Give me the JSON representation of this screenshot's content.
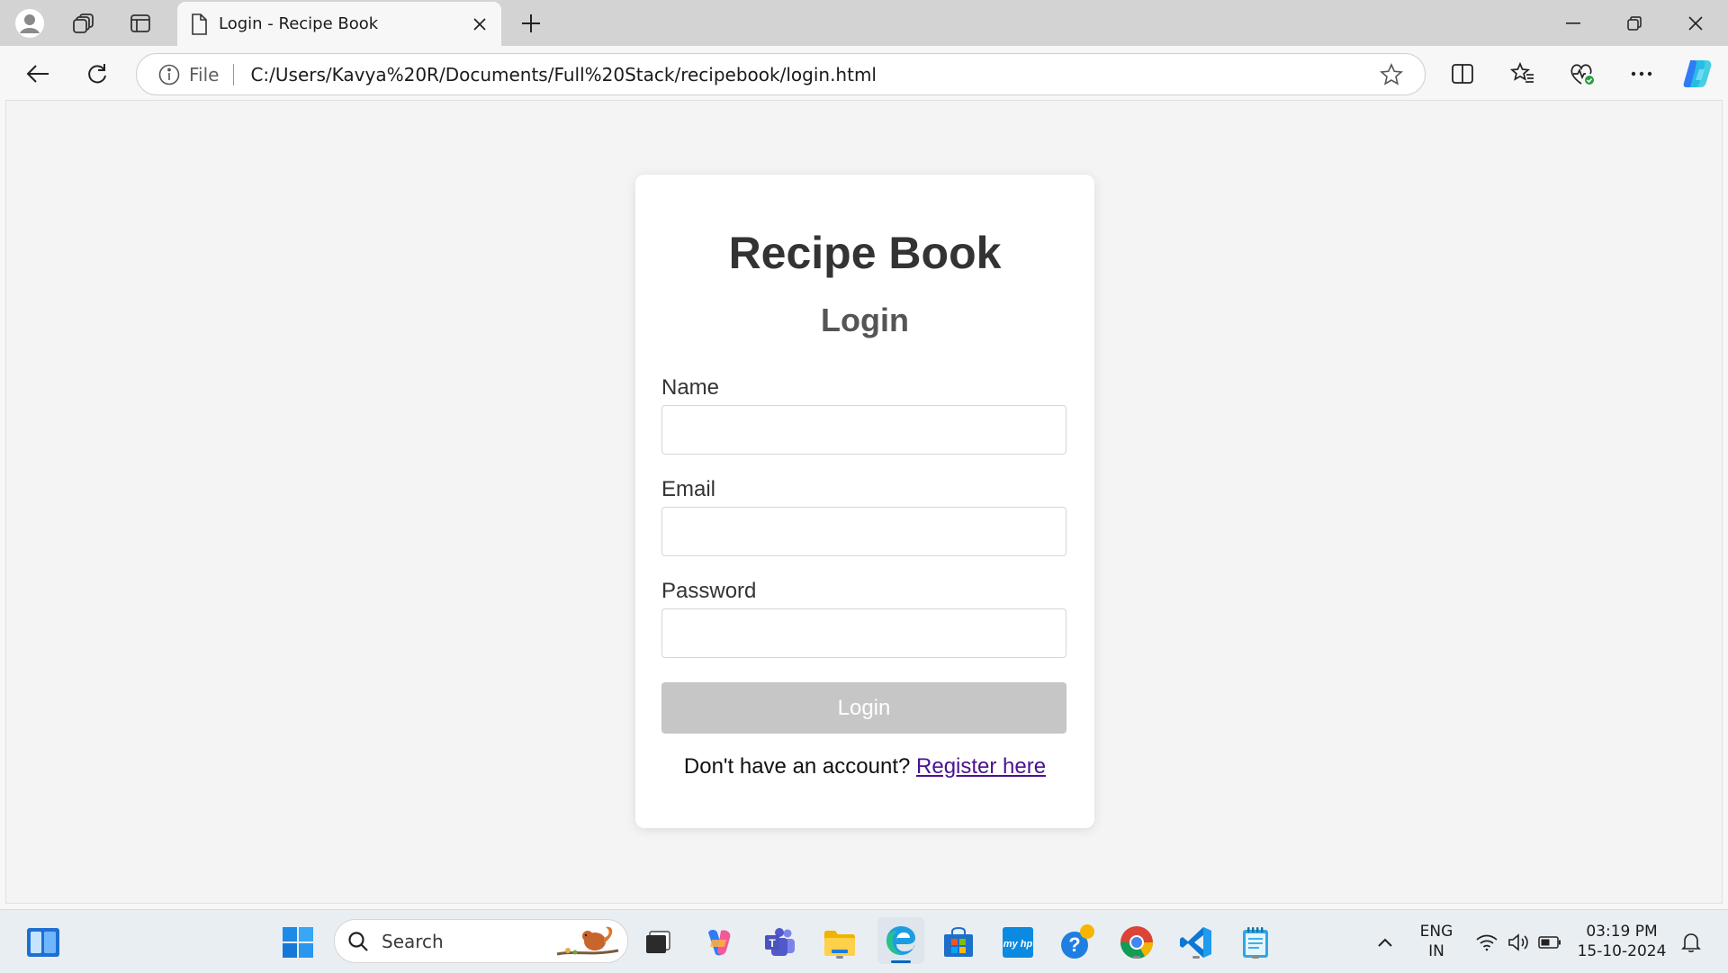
{
  "browser": {
    "tab_title": "Login - Recipe Book",
    "address_scheme_label": "File",
    "url": "C:/Users/Kavya%20R/Documents/Full%20Stack/recipebook/login.html"
  },
  "page": {
    "app_title": "Recipe Book",
    "form_title": "Login",
    "fields": [
      {
        "label": "Name",
        "value": "",
        "type": "text"
      },
      {
        "label": "Email",
        "value": "",
        "type": "email"
      },
      {
        "label": "Password",
        "value": "",
        "type": "password"
      }
    ],
    "submit_label": "Login",
    "submit_state": "disabled",
    "register_prompt": "Don't have an account?",
    "register_link": "Register here"
  },
  "taskbar": {
    "search_label": "Search",
    "lang_line1": "ENG",
    "lang_line2": "IN",
    "time": "03:19 PM",
    "date": "15-10-2024"
  },
  "colors": {
    "tabstrip": "#d3d3d3",
    "page_bg": "#f4f4f4",
    "card_bg": "#ffffff",
    "button_disabled": "#c6c6c6",
    "link": "#4b1290"
  }
}
